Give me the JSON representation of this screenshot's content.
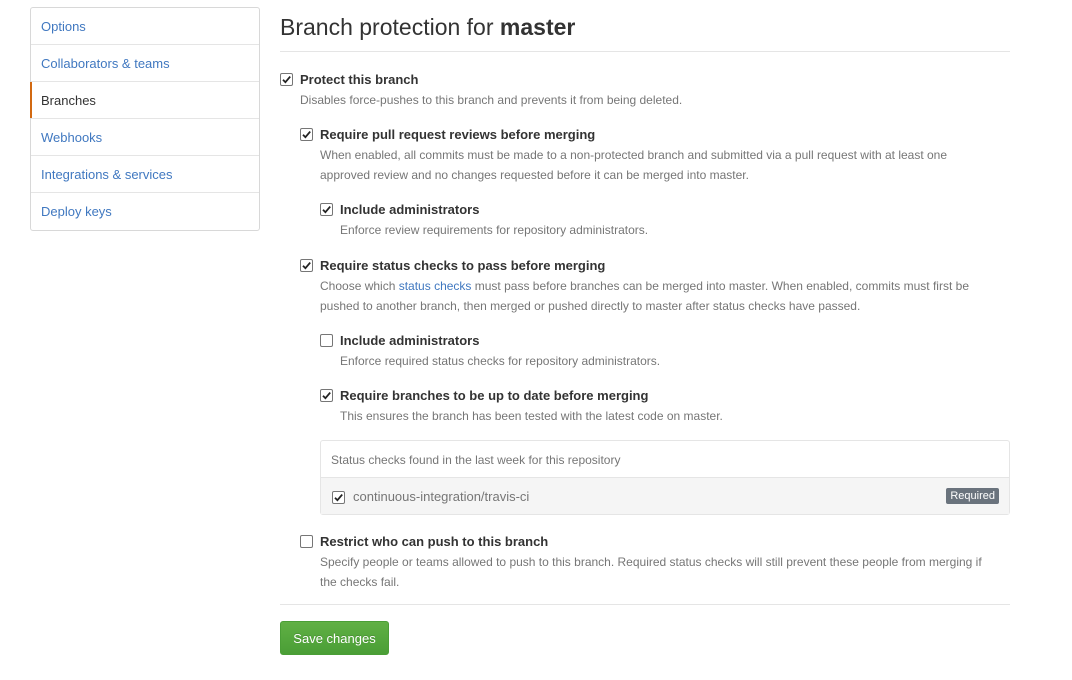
{
  "sidebar": {
    "items": [
      {
        "label": "Options",
        "selected": false
      },
      {
        "label": "Collaborators & teams",
        "selected": false
      },
      {
        "label": "Branches",
        "selected": true
      },
      {
        "label": "Webhooks",
        "selected": false
      },
      {
        "label": "Integrations & services",
        "selected": false
      },
      {
        "label": "Deploy keys",
        "selected": false
      }
    ]
  },
  "main": {
    "title_prefix": "Branch protection for",
    "title_branch": "master",
    "protect": {
      "label": "Protect this branch",
      "desc": "Disables force-pushes to this branch and prevents it from being deleted.",
      "checked": true
    },
    "reviews": {
      "label": "Require pull request reviews before merging",
      "desc": "When enabled, all commits must be made to a non-protected branch and submitted via a pull request with at least one approved review and no changes requested before it can be merged into master.",
      "checked": true
    },
    "reviews_admins": {
      "label": "Include administrators",
      "desc": "Enforce review requirements for repository administrators.",
      "checked": true
    },
    "status_checks": {
      "label": "Require status checks to pass before merging",
      "desc_before": "Choose which ",
      "desc_link": "status checks",
      "desc_after": " must pass before branches can be merged into master. When enabled, commits must first be pushed to another branch, then merged or pushed directly to master after status checks have passed.",
      "checked": true
    },
    "status_admins": {
      "label": "Include administrators",
      "desc": "Enforce required status checks for repository administrators.",
      "checked": false
    },
    "up_to_date": {
      "label": "Require branches to be up to date before merging",
      "desc": "This ensures the branch has been tested with the latest code on master.",
      "checked": true
    },
    "checks_box": {
      "header": "Status checks found in the last week for this repository",
      "items": [
        {
          "name": "continuous-integration/travis-ci",
          "checked": true,
          "badge": "Required"
        }
      ]
    },
    "restrict": {
      "label": "Restrict who can push to this branch",
      "desc": "Specify people or teams allowed to push to this branch. Required status checks will still prevent these people from merging if the checks fail.",
      "checked": false
    },
    "save_label": "Save changes"
  },
  "colors": {
    "link": "#4078c0",
    "selected_accent": "#d26911",
    "save_button": "#55a532",
    "badge_bg": "#6a737d"
  }
}
